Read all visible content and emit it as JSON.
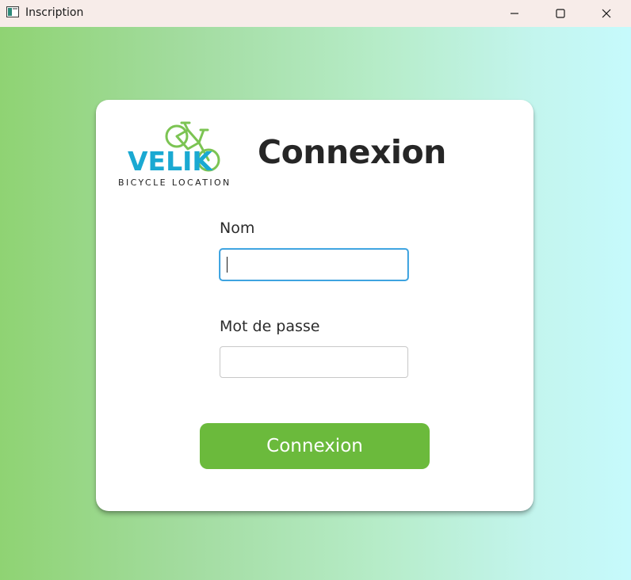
{
  "window": {
    "title": "Inscription",
    "controls": {
      "minimize_icon": "minimize-icon",
      "maximize_icon": "maximize-icon",
      "close_icon": "close-icon"
    }
  },
  "logo": {
    "brand": "VELIK",
    "tagline": "BICYCLE LOCATION",
    "icon": "bicycle-icon",
    "brand_color": "#1aa9d2",
    "bike_color": "#7cc453"
  },
  "form": {
    "heading": "Connexion",
    "name_label": "Nom",
    "name_value": "",
    "password_label": "Mot de passe",
    "password_value": "",
    "submit_label": "Connexion"
  },
  "colors": {
    "accent": "#6bba3c",
    "focus_border": "#1d8fd6",
    "gradient_start": "#8fd373",
    "gradient_end": "#c6fafc"
  }
}
